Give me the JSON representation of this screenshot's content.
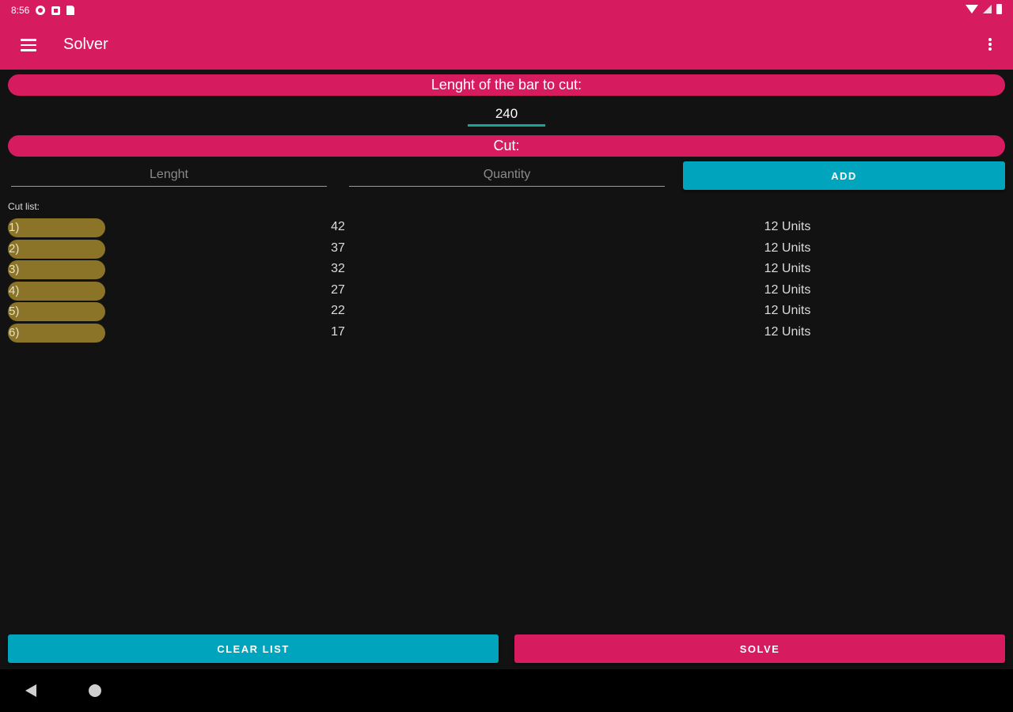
{
  "status_bar": {
    "time": "8:56"
  },
  "app_bar": {
    "title": "Solver"
  },
  "bar_section": {
    "label": "Lenght of the bar to cut:",
    "value": "240"
  },
  "cut_section": {
    "label": "Cut:",
    "length_placeholder": "Lenght",
    "quantity_placeholder": "Quantity",
    "add_label": "ADD"
  },
  "cut_list": {
    "label": "Cut list:",
    "items": [
      {
        "index": "1)",
        "length": "42",
        "quantity": "12 Units"
      },
      {
        "index": "2)",
        "length": "37",
        "quantity": "12 Units"
      },
      {
        "index": "3)",
        "length": "32",
        "quantity": "12 Units"
      },
      {
        "index": "4)",
        "length": "27",
        "quantity": "12 Units"
      },
      {
        "index": "5)",
        "length": "22",
        "quantity": "12 Units"
      },
      {
        "index": "6)",
        "length": "17",
        "quantity": "12 Units"
      }
    ]
  },
  "actions": {
    "clear_label": "CLEAR LIST",
    "solve_label": "SOLVE"
  },
  "colors": {
    "primary": "#d61c5f",
    "accent": "#00a4bc",
    "index_pill": "#8b7427",
    "input_underline": "#1aa39a"
  },
  "icons": {
    "menu": "hamburger-icon",
    "overflow": "more-vert-icon",
    "back": "back-triangle-icon",
    "home": "home-circle-icon"
  }
}
